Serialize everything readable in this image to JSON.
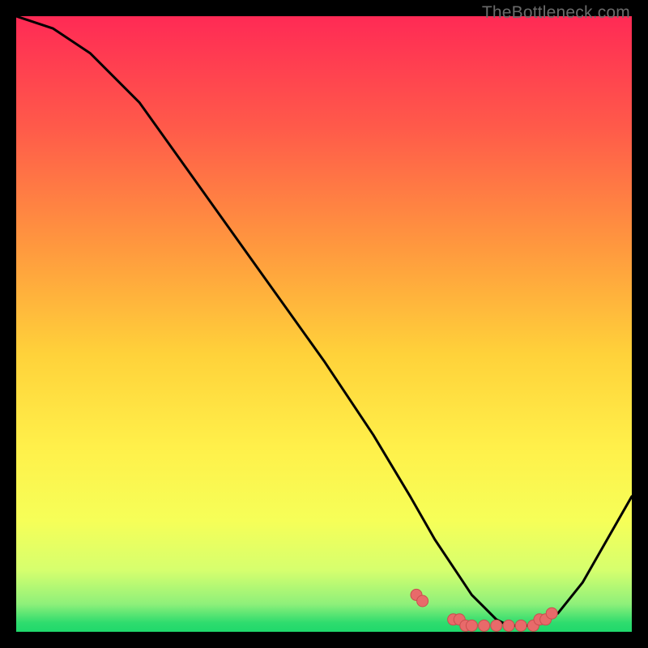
{
  "watermark": "TheBottleneck.com",
  "colors": {
    "black": "#000000",
    "curve": "#000000",
    "marker_fill": "#e86a6a",
    "marker_stroke": "#c94f4f",
    "grad_top": "#ff2a55",
    "grad_1": "#ff6b4a",
    "grad_2": "#ffb23a",
    "grad_3": "#ffe13a",
    "grad_4": "#faff58",
    "grad_5": "#d6ff6e",
    "grad_bottom": "#1fd86b"
  },
  "chart_data": {
    "type": "line",
    "title": "",
    "xlabel": "",
    "ylabel": "",
    "xlim": [
      0,
      100
    ],
    "ylim": [
      0,
      100
    ],
    "series": [
      {
        "name": "bottleneck-curve",
        "x": [
          0,
          6,
          12,
          20,
          30,
          40,
          50,
          58,
          64,
          68,
          72,
          74,
          76,
          78,
          80,
          82,
          84,
          86,
          88,
          92,
          96,
          100
        ],
        "values": [
          100,
          98,
          94,
          86,
          72,
          58,
          44,
          32,
          22,
          15,
          9,
          6,
          4,
          2,
          1,
          1,
          1,
          2,
          3,
          8,
          15,
          22
        ]
      }
    ],
    "markers": {
      "name": "highlighted-range",
      "x": [
        65,
        66,
        71,
        72,
        73,
        74,
        76,
        78,
        80,
        82,
        84,
        85,
        86,
        87
      ],
      "values": [
        6,
        5,
        2,
        2,
        1,
        1,
        1,
        1,
        1,
        1,
        1,
        2,
        2,
        3
      ]
    }
  }
}
